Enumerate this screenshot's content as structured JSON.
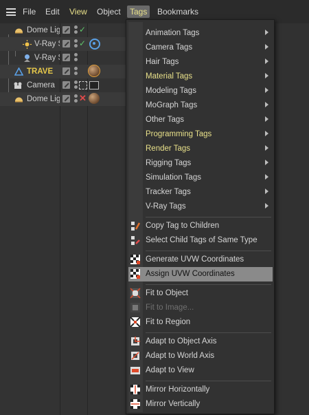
{
  "menubar": {
    "items": [
      "File",
      "Edit",
      "View",
      "Object",
      "Tags",
      "Bookmarks"
    ],
    "active": "Tags"
  },
  "object_manager": {
    "rows": [
      {
        "name": "Dome Lig",
        "tag": "check"
      },
      {
        "name": "V-Ray S",
        "tag": "check"
      },
      {
        "name": "V-Ray S",
        "tag": "none"
      },
      {
        "name": "TRAVE",
        "tag": "none"
      },
      {
        "name": "Camera",
        "tag": "none"
      },
      {
        "name": "Dome Lig",
        "tag": "cross"
      }
    ]
  },
  "tags_menu": {
    "submenus": [
      {
        "label": "Animation Tags",
        "highlight": false
      },
      {
        "label": "Camera Tags",
        "highlight": false
      },
      {
        "label": "Hair Tags",
        "highlight": false
      },
      {
        "label": "Material Tags",
        "highlight": true
      },
      {
        "label": "Modeling Tags",
        "highlight": false
      },
      {
        "label": "MoGraph Tags",
        "highlight": false
      },
      {
        "label": "Other Tags",
        "highlight": false
      },
      {
        "label": "Programming Tags",
        "highlight": true
      },
      {
        "label": "Render Tags",
        "highlight": true
      },
      {
        "label": "Rigging Tags",
        "highlight": false
      },
      {
        "label": "Simulation Tags",
        "highlight": false
      },
      {
        "label": "Tracker Tags",
        "highlight": false
      },
      {
        "label": "V-Ray Tags",
        "highlight": false
      }
    ],
    "group1": [
      "Copy Tag to Children",
      "Select Child Tags of Same Type"
    ],
    "group2": [
      "Generate UVW Coordinates",
      "Assign UVW Coordinates"
    ],
    "group3": [
      "Fit to Object",
      "Fit to Image...",
      "Fit to Region"
    ],
    "group4": [
      "Adapt to Object Axis",
      "Adapt to World Axis",
      "Adapt to View"
    ],
    "group5": [
      "Mirror Horizontally",
      "Mirror Vertically"
    ],
    "selected": "Assign UVW Coordinates",
    "disabled": "Fit to Image...",
    "colors": {
      "highlight": "#e8e08a",
      "selected_bg": "#8a8a8a",
      "accent": "#e6a23c"
    }
  }
}
